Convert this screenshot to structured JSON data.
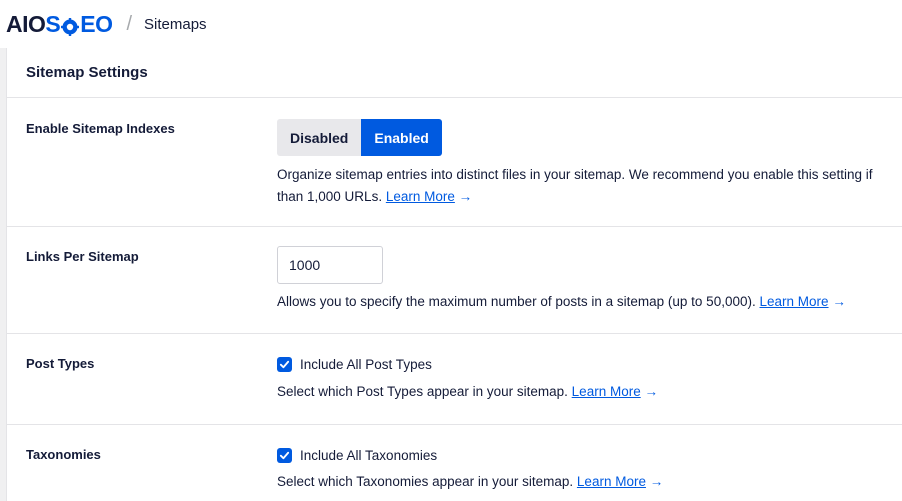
{
  "header": {
    "logo": {
      "aio": "AIO",
      "s": "S",
      "eo": "EO"
    },
    "separator": "/",
    "breadcrumb": "Sitemaps"
  },
  "colors": {
    "accent": "#005ae0",
    "text": "#141b38",
    "muted_bg": "#e8e8eb"
  },
  "card": {
    "title": "Sitemap Settings"
  },
  "settings": {
    "indexes": {
      "label": "Enable Sitemap Indexes",
      "options": [
        "Disabled",
        "Enabled"
      ],
      "selected": "Enabled",
      "description": "Organize sitemap entries into distinct files in your sitemap. We recommend you enable this setting if",
      "description_line2": "than 1,000 URLs.",
      "link": "Learn More",
      "arrow": "→"
    },
    "links_per_sitemap": {
      "label": "Links Per Sitemap",
      "value": "1000",
      "description": "Allows you to specify the maximum number of posts in a sitemap (up to 50,000).",
      "link": "Learn More",
      "arrow": "→"
    },
    "post_types": {
      "label": "Post Types",
      "checkbox_label": "Include All Post Types",
      "checked": true,
      "description": "Select which Post Types appear in your sitemap.",
      "link": "Learn More",
      "arrow": "→"
    },
    "taxonomies": {
      "label": "Taxonomies",
      "checkbox_label": "Include All Taxonomies",
      "checked": true,
      "description": "Select which Taxonomies appear in your sitemap.",
      "link": "Learn More",
      "arrow": "→"
    }
  }
}
